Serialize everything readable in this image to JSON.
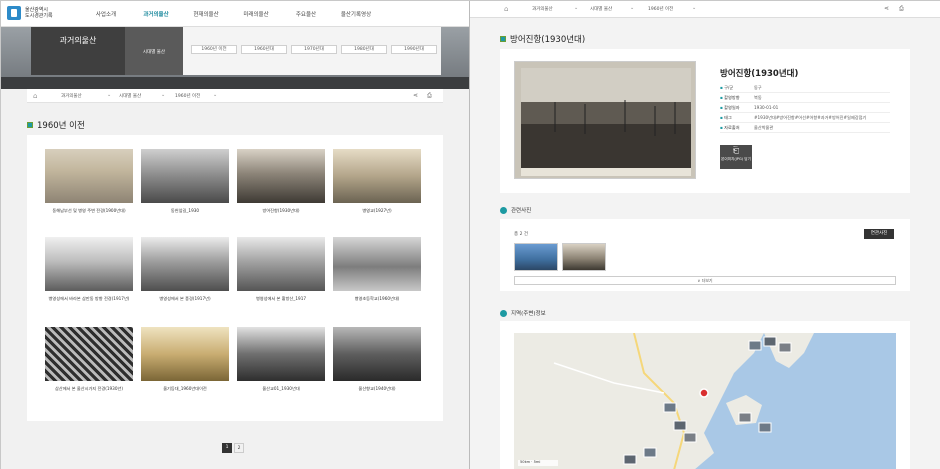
{
  "left": {
    "logo": {
      "line1": "울산광역시",
      "line2": "도시경관기록"
    },
    "gnb": [
      "사업소개",
      "과거의울산",
      "현재의울산",
      "미래의울산",
      "주요울산",
      "울산기록영상"
    ],
    "gnb_active_index": 1,
    "hero": {
      "title": "과거의울산",
      "sub": "시대별 울산",
      "tabs": [
        "1960년 이전",
        "1960년대",
        "1970년대",
        "1980년대",
        "1990년대"
      ]
    },
    "breadcrumb": [
      "과거의울산",
      "시대별 울산",
      "1960년 이전"
    ],
    "section_title": "1960년 이전",
    "cards": [
      "동해남부선 및 병영 주변 전경(1900년대)",
      "동헌앞길_1930",
      "방어진항(1930년대)",
      "병영교(1927년)",
      "병영성에서 바라본 삼만동 방향 전경(1917년)",
      "병영성에서 본 풍경(1917년)",
      "병영성에서 본 황방산_1917",
      "병영초등학교(1960년대)",
      "삼산에서 본 울산시가지 전경(1930년)",
      "울기등대_1960년대이전",
      "울산교01_1930년대",
      "울산향교(1940년대)"
    ],
    "pages": [
      "1",
      "2"
    ]
  },
  "right": {
    "breadcrumb": [
      "과거의울산",
      "시대별 울산",
      "1960년 이전"
    ],
    "section_title": "방어진항(1930년대)",
    "detail_title": "방어진항(1930년대)",
    "meta": [
      {
        "k": "구/군",
        "v": "동구"
      },
      {
        "k": "촬영방향",
        "v": "북동"
      },
      {
        "k": "촬영일자",
        "v": "1930-01-01"
      },
      {
        "k": "태그",
        "v": "#1930년대#방어진항#어선#어항#과거#방어진#일제강점기"
      },
      {
        "k": "자료출처",
        "v": "울산박물관"
      }
    ],
    "download_label": "본이미지(JPG) 담기",
    "related_title": "관련사진",
    "related_count": "총 2 건",
    "related_button": "연관사진",
    "more_label": "∨ 더보기",
    "map_title": "지역(주변)정보",
    "map_scale": "50km · 5mi"
  },
  "colors": {
    "accent": "#1d9aa2",
    "nav_active": "#1d8a9e",
    "dark": "#3f3f3f"
  }
}
